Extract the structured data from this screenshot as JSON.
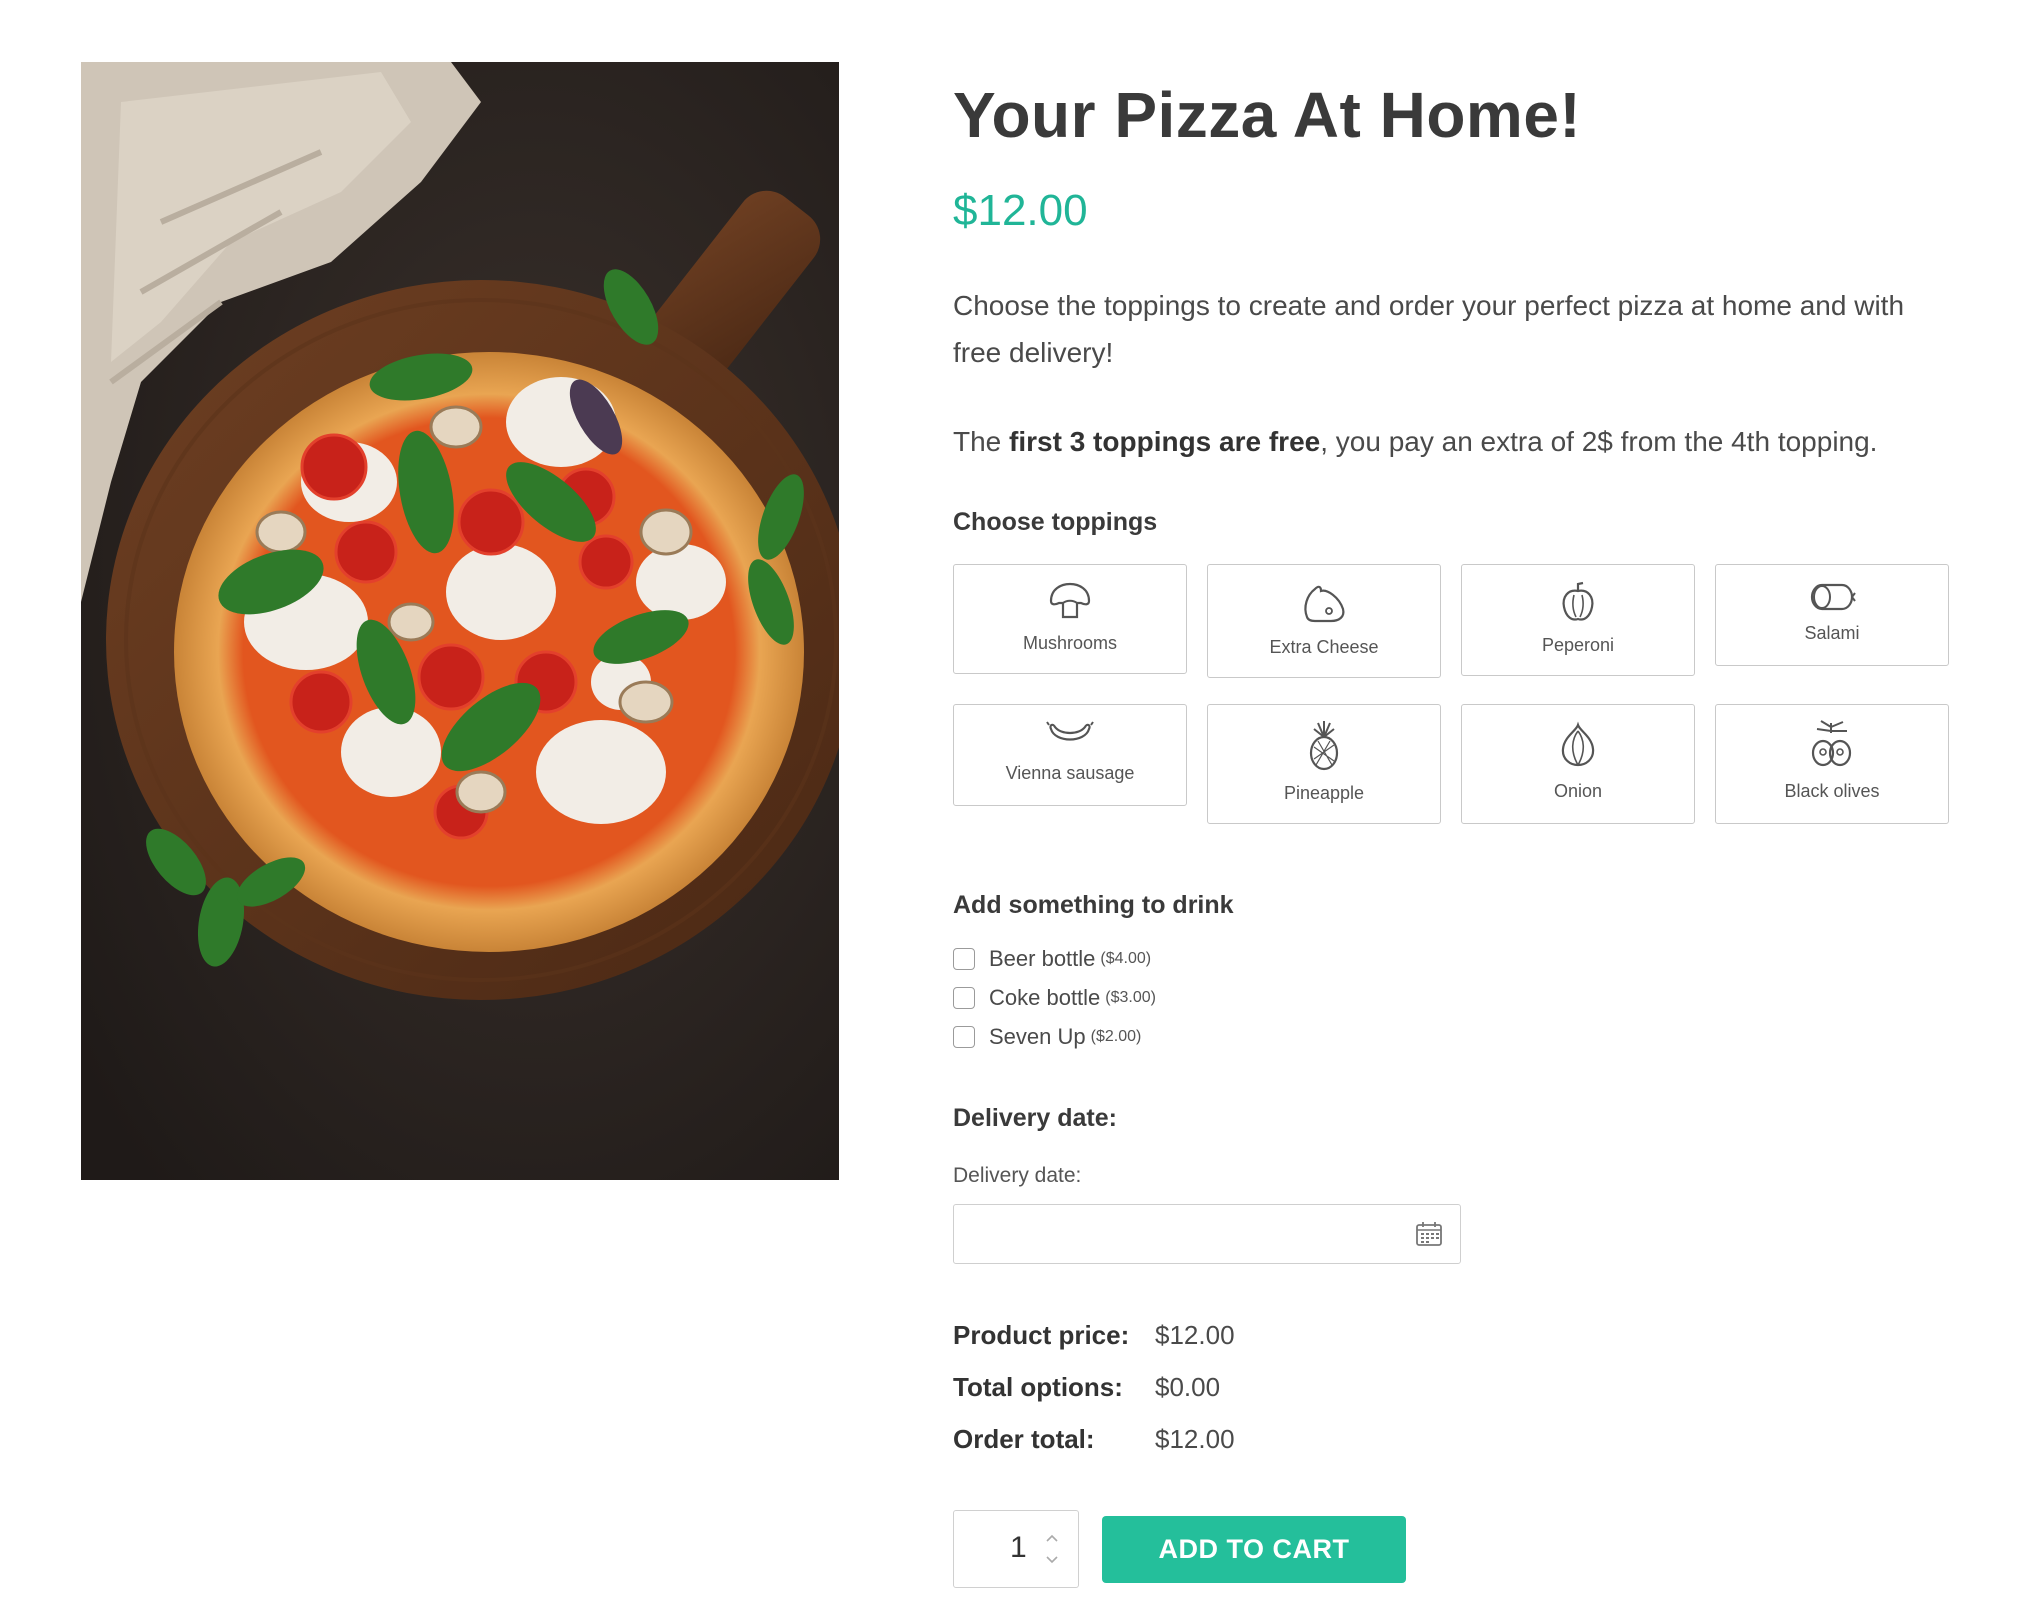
{
  "product": {
    "title": "Your Pizza At Home!",
    "price": "$12.00",
    "description": "Choose the toppings to create and order your perfect pizza at home and with free delivery!",
    "note_prefix": "The ",
    "note_bold": "first 3 toppings are free",
    "note_suffix": ", you pay an extra of 2$ from the 4th topping."
  },
  "toppings": {
    "heading": "Choose toppings",
    "items": [
      {
        "label": "Mushrooms",
        "icon": "mushroom-icon"
      },
      {
        "label": "Extra Cheese",
        "icon": "cheese-icon"
      },
      {
        "label": "Peperoni",
        "icon": "pepper-icon"
      },
      {
        "label": "Salami",
        "icon": "salami-icon"
      },
      {
        "label": "Vienna sausage",
        "icon": "sausage-icon"
      },
      {
        "label": "Pineapple",
        "icon": "pineapple-icon"
      },
      {
        "label": "Onion",
        "icon": "onion-icon"
      },
      {
        "label": "Black olives",
        "icon": "olives-icon"
      }
    ]
  },
  "drinks": {
    "heading": "Add something to drink",
    "items": [
      {
        "name": "Beer bottle",
        "price": "($4.00)"
      },
      {
        "name": "Coke bottle",
        "price": "($3.00)"
      },
      {
        "name": "Seven Up",
        "price": "($2.00)"
      }
    ]
  },
  "delivery": {
    "heading": "Delivery date:",
    "field_label": "Delivery date:",
    "value": "",
    "icon": "calendar-icon"
  },
  "totals": {
    "product_price_label": "Product price:",
    "product_price": "$12.00",
    "total_options_label": "Total options:",
    "total_options": "$0.00",
    "order_total_label": "Order total:",
    "order_total": "$12.00"
  },
  "cart": {
    "quantity": "1",
    "add_label": "ADD TO CART"
  },
  "colors": {
    "accent": "#24bf9b",
    "price": "#20b597",
    "text": "#3a3a3a",
    "border": "#c9c9c9"
  }
}
